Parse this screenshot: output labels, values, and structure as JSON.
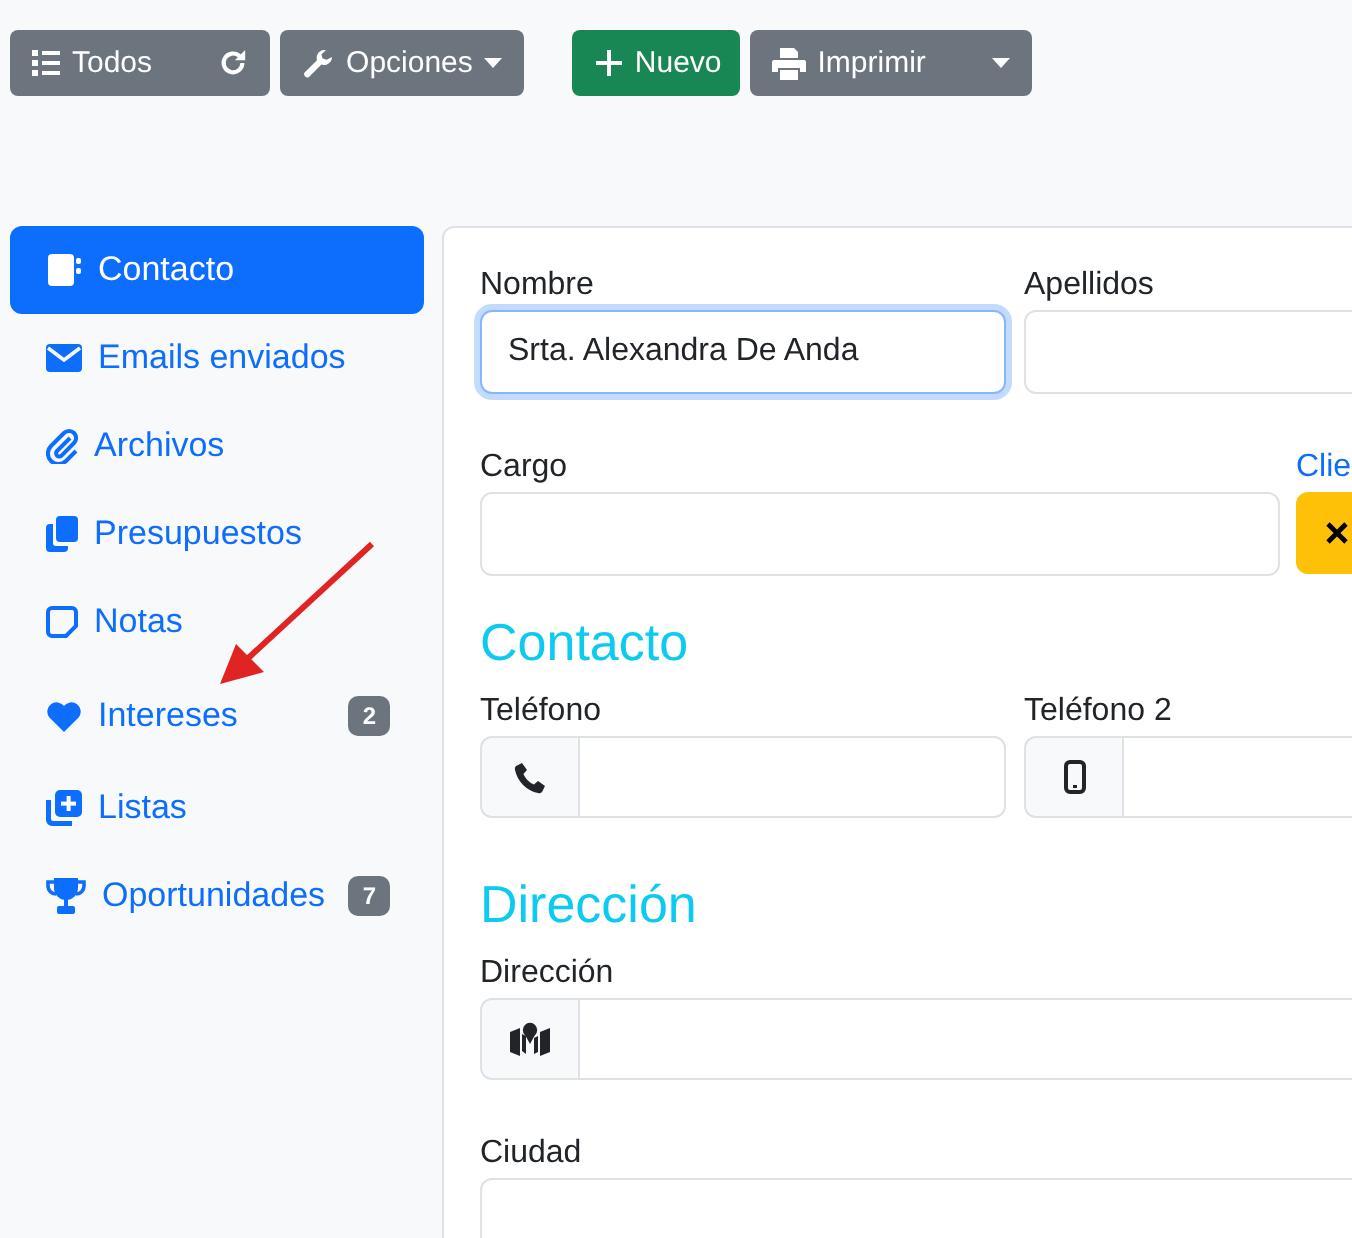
{
  "toolbar": [
    {
      "kind": "group",
      "label": "Todos"
    },
    {
      "kind": "dropdown",
      "label": "Opciones"
    },
    {
      "kind": "primary",
      "label": "Nuevo"
    },
    {
      "kind": "split",
      "label": "Imprimir"
    }
  ],
  "sidebar": {
    "items": [
      {
        "label": "Contacto",
        "selected": true
      },
      {
        "label": "Emails enviados",
        "selected": false
      },
      {
        "label": "Archivos",
        "selected": false
      },
      {
        "label": "Presupuestos",
        "selected": false
      },
      {
        "label": "Notas",
        "selected": false
      },
      {
        "label": "Intereses",
        "selected": false,
        "badge": "2"
      },
      {
        "label": "Listas",
        "selected": false
      },
      {
        "label": "Oportunidades",
        "selected": false,
        "badge": "7"
      }
    ]
  },
  "form": {
    "rows": [
      [
        {
          "label": "Nombre",
          "kind": "text",
          "value": "Srta. Alexandra De Anda",
          "focused": true
        },
        {
          "label": "Apellidos",
          "kind": "text",
          "focused": false
        }
      ],
      [
        {
          "label": "Cargo",
          "kind": "text",
          "focused": false
        },
        {
          "label": "Clie",
          "kind": "clear"
        }
      ]
    ],
    "sections": [
      {
        "title": "Contacto",
        "rows": [
          [
            {
              "label": "Teléfono",
              "kind": "phone",
              "focused": false
            },
            {
              "label": "Teléfono 2",
              "kind": "mobile",
              "focused": false
            }
          ]
        ]
      },
      {
        "title": "Dirección",
        "rows": [
          [
            {
              "label": "Dirección",
              "kind": "map",
              "focused": false
            }
          ],
          [
            {
              "label": "Ciudad",
              "kind": "text",
              "focused": false
            }
          ]
        ]
      }
    ]
  }
}
